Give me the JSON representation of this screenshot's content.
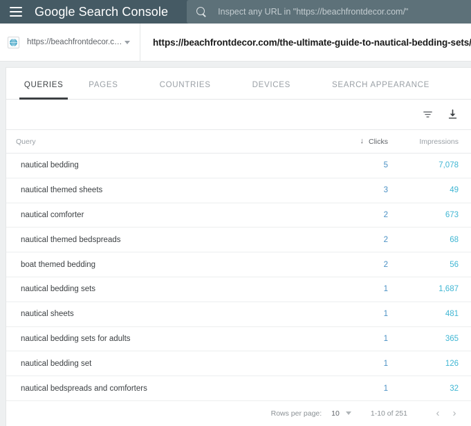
{
  "appbar": {
    "menu_icon": "hamburger-menu-icon",
    "brand_primary": "Google",
    "brand_secondary": "Search Console",
    "search_icon": "search-icon",
    "search_placeholder": "Inspect any URL in \"https://beachfrontdecor.com/\"",
    "search_value": "",
    "background_color": "#455a64",
    "search_background_color": "#5d7179"
  },
  "urlbar": {
    "property_icon": "globe-icon",
    "property_url": "https://beachfrontdecor.com/",
    "property_caret_icon": "chevron-down-icon",
    "inspected_url": "https://beachfrontdecor.com/the-ultimate-guide-to-nautical-bedding-sets/"
  },
  "tabs": {
    "active_index": 0,
    "items": [
      {
        "label": "QUERIES"
      },
      {
        "label": "PAGES"
      },
      {
        "label": "COUNTRIES"
      },
      {
        "label": "DEVICES"
      },
      {
        "label": "SEARCH APPEARANCE"
      }
    ]
  },
  "toolbar": {
    "filter_icon": "filter-icon",
    "download_icon": "download-icon"
  },
  "table": {
    "columns": {
      "query": "Query",
      "clicks": "Clicks",
      "impressions": "Impressions"
    },
    "sort": {
      "column": "clicks",
      "direction_icon": "arrow-down-icon",
      "direction_glyph": "↓"
    },
    "rows": [
      {
        "query": "nautical bedding",
        "clicks": "5",
        "impressions": "7,078"
      },
      {
        "query": "nautical themed sheets",
        "clicks": "3",
        "impressions": "49"
      },
      {
        "query": "nautical comforter",
        "clicks": "2",
        "impressions": "673"
      },
      {
        "query": "nautical themed bedspreads",
        "clicks": "2",
        "impressions": "68"
      },
      {
        "query": "boat themed bedding",
        "clicks": "2",
        "impressions": "56"
      },
      {
        "query": "nautical bedding sets",
        "clicks": "1",
        "impressions": "1,687"
      },
      {
        "query": "nautical sheets",
        "clicks": "1",
        "impressions": "481"
      },
      {
        "query": "nautical bedding sets for adults",
        "clicks": "1",
        "impressions": "365"
      },
      {
        "query": "nautical bedding set",
        "clicks": "1",
        "impressions": "126"
      },
      {
        "query": "nautical bedspreads and comforters",
        "clicks": "1",
        "impressions": "32"
      }
    ]
  },
  "pagination": {
    "rows_per_page_label": "Rows per page:",
    "rows_per_page_value": "10",
    "rows_per_page_caret_icon": "chevron-down-icon",
    "range_text": "1-10 of 251",
    "prev_icon": "chevron-left-icon",
    "prev_glyph": "‹",
    "next_icon": "chevron-right-icon",
    "next_glyph": "›"
  },
  "colors": {
    "header": "#455a64",
    "clicks_value": "#4a90c4",
    "impressions_value": "#3fb6d3",
    "active_tab": "#3c4043"
  }
}
